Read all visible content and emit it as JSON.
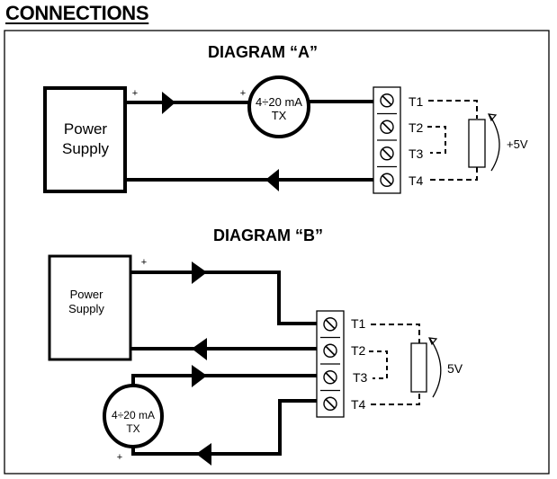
{
  "page": {
    "title": "CONNECTIONS"
  },
  "diagram_a": {
    "heading": "DIAGRAM “A”",
    "power_supply": {
      "line1": "Power",
      "line2": "Supply"
    },
    "transmitter": {
      "line1": "4÷20 mA",
      "line2": "TX"
    },
    "polarity_ps": "+",
    "polarity_tx": "+",
    "terminals": [
      "T1",
      "T2",
      "T3",
      "T4"
    ],
    "voltage": "+5V"
  },
  "diagram_b": {
    "heading": "DIAGRAM “B”",
    "power_supply": {
      "line1": "Power",
      "line2": "Supply"
    },
    "transmitter": {
      "line1": "4÷20 mA",
      "line2": "TX"
    },
    "polarity_ps": "+",
    "polarity_tx": "+",
    "terminals": [
      "T1",
      "T2",
      "T3",
      "T4"
    ],
    "voltage": "5V"
  },
  "colors": {
    "line": "#000000",
    "background": "#ffffff"
  }
}
